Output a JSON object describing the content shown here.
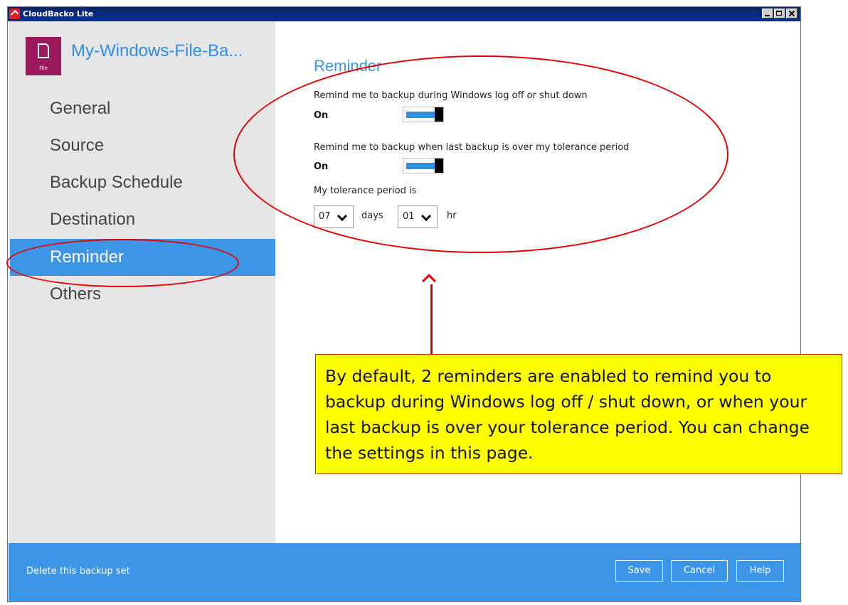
{
  "window": {
    "title": "CloudBacko Lite"
  },
  "header": {
    "backup_set_name": "My-Windows-File-Ba...",
    "file_icon_label": "File"
  },
  "sidebar": {
    "items": [
      {
        "label": "General"
      },
      {
        "label": "Source"
      },
      {
        "label": "Backup Schedule"
      },
      {
        "label": "Destination"
      },
      {
        "label": "Reminder",
        "active": true
      },
      {
        "label": "Others"
      }
    ]
  },
  "main": {
    "title": "Reminder",
    "logoff_reminder": {
      "label": "Remind me to backup during Windows log off or shut down",
      "state": "On"
    },
    "tolerance_reminder": {
      "label": "Remind me to backup when last backup is over my tolerance period",
      "state": "On"
    },
    "tolerance": {
      "label": "My tolerance period is",
      "days_value": "07",
      "days_unit": "days",
      "hours_value": "01",
      "hours_unit": "hr"
    }
  },
  "footer": {
    "delete_label": "Delete this backup set",
    "save_label": "Save",
    "cancel_label": "Cancel",
    "help_label": "Help"
  },
  "annotation": {
    "note": "By default, 2 reminders are enabled to remind you to backup during Windows log off / shut down, or when your last backup is over your tolerance period. You can change the settings in this page."
  },
  "colors": {
    "accent": "#3d95e8",
    "sidebar_bg": "#e6e6e6",
    "annotation_red": "#e40000",
    "note_yellow": "#ffff00",
    "file_icon": "#9b1a5c"
  },
  "icons": [
    "app-icon",
    "file-icon",
    "chevron-down-icon",
    "minimize-icon",
    "maximize-icon",
    "close-icon"
  ]
}
